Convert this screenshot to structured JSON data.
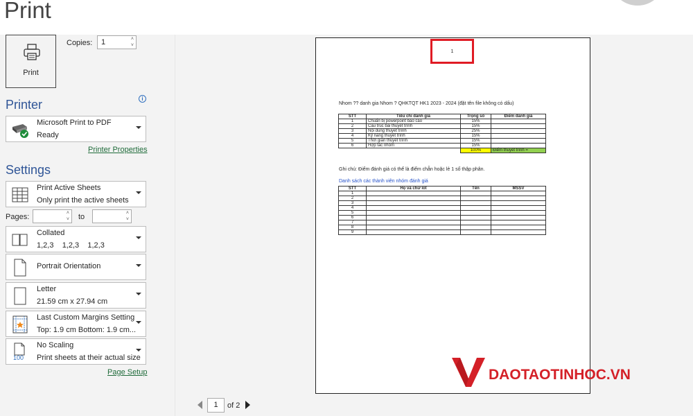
{
  "header": {
    "title": "Print"
  },
  "print_button": {
    "label": "Print"
  },
  "copies": {
    "label": "Copies:",
    "value": "1"
  },
  "printer": {
    "section_title": "Printer",
    "name": "Microsoft Print to PDF",
    "status": "Ready",
    "properties_link": "Printer Properties"
  },
  "settings": {
    "section_title": "Settings",
    "what": {
      "line1": "Print Active Sheets",
      "line2": "Only print the active sheets"
    },
    "pages": {
      "label": "Pages:",
      "from": "",
      "to_label": "to",
      "to": ""
    },
    "collation": {
      "line1": "Collated",
      "line2": "1,2,3    1,2,3    1,2,3"
    },
    "orientation": {
      "line1": "Portrait Orientation"
    },
    "paper": {
      "line1": "Letter",
      "line2": "21.59 cm x 27.94 cm"
    },
    "margins": {
      "line1": "Last Custom Margins Setting",
      "line2": "Top: 1.9 cm Bottom: 1.9 cm..."
    },
    "scaling": {
      "line1": "No Scaling",
      "line2": "Print sheets at their actual size",
      "icon_text": "100"
    },
    "page_setup_link": "Page Setup"
  },
  "preview": {
    "header_page_number": "1",
    "doc_title": "Nhom ?? danh gia Nhom ? QHKTQT HK1 2023 - 2024 (đặt tên file không có dấu)",
    "criteria_table": {
      "headers": [
        "STT",
        "Tiêu chí đánh giá",
        "Trọng số",
        "Điểm đánh giá"
      ],
      "rows": [
        [
          "1",
          "Chuẩn bị powerpoint báo cáo",
          "15%",
          ""
        ],
        [
          "2",
          "Cấu trúc bài thuyết trình",
          "15%",
          ""
        ],
        [
          "3",
          "Nội dung thuyết trình",
          "25%",
          ""
        ],
        [
          "4",
          "Kỹ năng thuyết trình",
          "15%",
          ""
        ],
        [
          "5",
          "Thời gian thuyết trình",
          "15%",
          ""
        ],
        [
          "6",
          "Hợp tác nhóm",
          "15%",
          ""
        ]
      ],
      "total_weight": "100%",
      "total_label": "Điểm thuyết trình ="
    },
    "note": "Ghi chú: Điểm đánh giá có thể là điểm chẵn hoặc lẻ 1 số thập phân.",
    "member_list_title": "Danh sách các thành viên nhóm đánh giá",
    "member_table": {
      "headers": [
        "STT",
        "Họ và chữ lót",
        "Tên",
        "MSSV"
      ],
      "rows": [
        "1",
        "2",
        "3",
        "4",
        "5",
        "6",
        "7",
        "8",
        "9"
      ]
    }
  },
  "pagination": {
    "current": "1",
    "of_label": "of 2"
  },
  "watermark": {
    "text": "DAOTAOTINHOC.VN"
  },
  "colors": {
    "accent": "#2f5597",
    "link": "#1f6b3a",
    "highlight_box": "#e01b24",
    "watermark": "#d42027"
  }
}
